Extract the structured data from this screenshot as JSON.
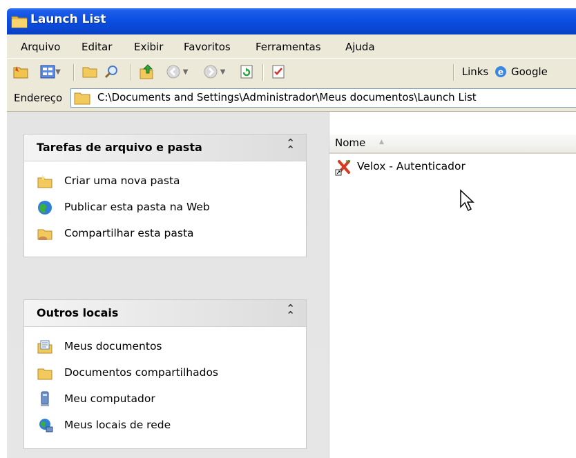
{
  "window": {
    "title": "Launch List"
  },
  "menu": [
    "Arquivo",
    "Editar",
    "Exibir",
    "Favoritos",
    "Ferramentas",
    "Ajuda"
  ],
  "toolbar": {
    "links_label": "Links",
    "google_label": "Google"
  },
  "address": {
    "label": "Endereço",
    "path": "C:\\Documents and Settings\\Administrador\\Meus documentos\\Launch List"
  },
  "panels": {
    "tasks": {
      "title": "Tarefas de arquivo e pasta",
      "items": [
        "Criar uma nova pasta",
        "Publicar esta pasta na Web",
        "Compartilhar esta pasta"
      ]
    },
    "places": {
      "title": "Outros locais",
      "items": [
        "Meus documentos",
        "Documentos compartilhados",
        "Meu computador",
        "Meus locais de rede"
      ]
    }
  },
  "file_list": {
    "column": "Nome",
    "files": [
      "Velox - Autenticador"
    ]
  },
  "colors": {
    "titlebar": "#0b4fe3",
    "chrome": "#ece9d8",
    "pane": "#e4e4e4"
  }
}
